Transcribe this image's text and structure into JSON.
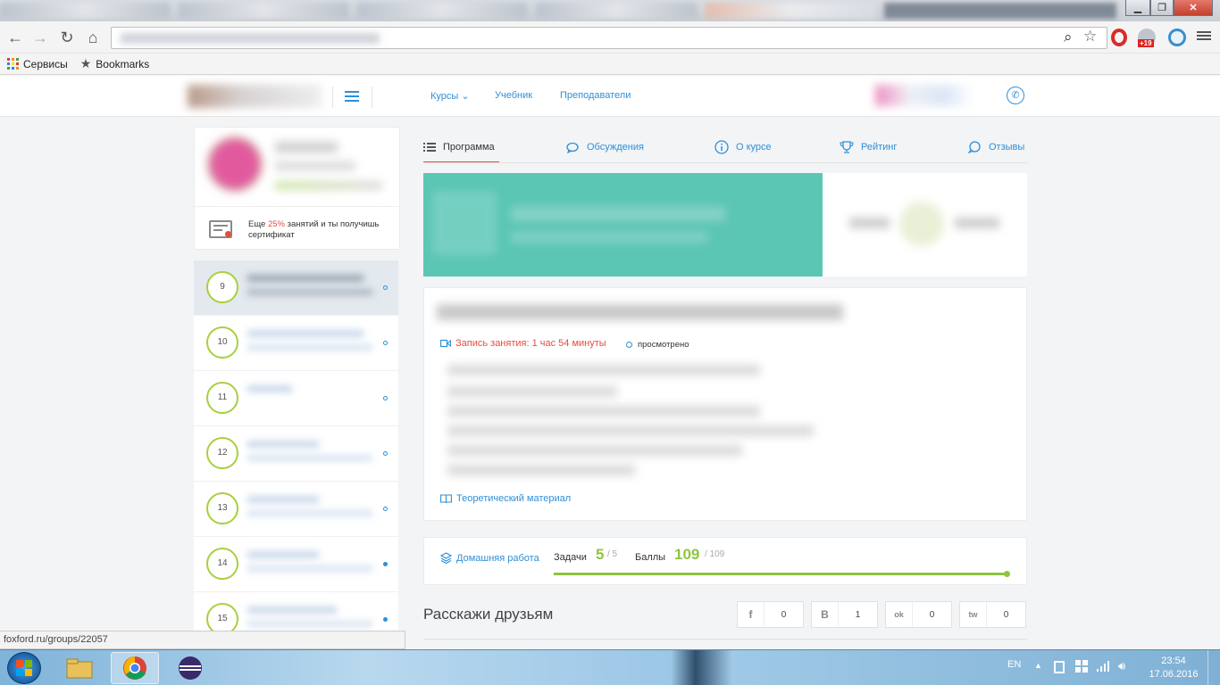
{
  "browser": {
    "window_controls": {
      "minimize": "▁",
      "maximize": "❐",
      "close": "✕"
    },
    "nav": {
      "back": "←",
      "forward": "→",
      "reload": "↻",
      "home": "⌂"
    },
    "omnibox": {
      "search_icon": "⌕",
      "star_icon": "☆"
    },
    "extensions": {
      "badge": "+19"
    },
    "bookmarks": [
      {
        "label": "Сервисы",
        "icon": "apps-grid-icon"
      },
      {
        "label": "Bookmarks",
        "icon": "star-icon"
      }
    ],
    "status_url": "foxford.ru/groups/22057"
  },
  "header": {
    "nav": [
      "Курсы",
      "Учебник",
      "Преподаватели"
    ],
    "nav_dropdown_glyph": "⌄"
  },
  "profile": {
    "certificate_text_pre": "Еще ",
    "certificate_percent": "25%",
    "certificate_text_post": " занятий и ты получишь сертификат"
  },
  "lessons": [
    {
      "num": "9"
    },
    {
      "num": "10"
    },
    {
      "num": "11"
    },
    {
      "num": "12"
    },
    {
      "num": "13"
    },
    {
      "num": "14"
    },
    {
      "num": "15"
    }
  ],
  "tabs": [
    "Программа",
    "Обсуждения",
    "О курсе",
    "Рейтинг",
    "Отзывы"
  ],
  "lesson_detail": {
    "recording": "Запись занятия: 1 час 54 минуты",
    "watched": "просмотрено",
    "theory": "Теоретический материал"
  },
  "homework": {
    "label": "Домашняя работа",
    "tasks_label": "Задачи",
    "tasks_done": "5",
    "tasks_total": "/ 5",
    "points_label": "Баллы",
    "points_done": "109",
    "points_total": "/ 109",
    "progress_fraction": 1.0
  },
  "share": {
    "title": "Расскажи друзьям",
    "items": [
      {
        "icon": "f",
        "count": "0"
      },
      {
        "icon": "B",
        "count": "1"
      },
      {
        "icon": "ok",
        "count": "0"
      },
      {
        "icon": "tw",
        "count": "0"
      }
    ]
  },
  "taskbar": {
    "lang": "EN",
    "time": "23:54",
    "date": "17.06.2016"
  },
  "colors": {
    "accent_blue": "#2f8fd6",
    "accent_green": "#8dc63f",
    "accent_red": "#e74c3c",
    "banner_teal": "#5cc6b5"
  }
}
